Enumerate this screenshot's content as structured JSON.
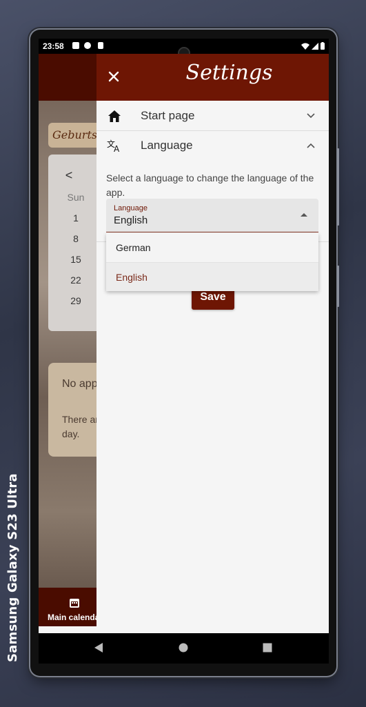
{
  "device": {
    "label": "Samsung Galaxy  S23 Ultra"
  },
  "statusbar": {
    "time": "23:58"
  },
  "background_app": {
    "chip_text": "Geburtst",
    "calendar": {
      "nav": "<",
      "weekday": "Sun",
      "days": [
        "1",
        "8",
        "15",
        "22",
        "29"
      ]
    },
    "card_title": "No app",
    "card_text_1": "There ar",
    "card_text_2": "day.",
    "nav_label": "Main calenda"
  },
  "drawer": {
    "title": "Settings",
    "close_icon": "close-icon",
    "sections": [
      {
        "icon": "home-icon",
        "label": "Start page",
        "expanded": false
      },
      {
        "icon": "translate-icon",
        "label": "Language",
        "expanded": true
      }
    ],
    "language_description": "Select a language to change the language of the app.",
    "select": {
      "label": "Language",
      "value": "English"
    },
    "options": [
      "German",
      "English"
    ],
    "selected_option": "English",
    "save_label": "Save"
  },
  "colors": {
    "primary": "#6e1604",
    "background": "#f5f5f5"
  }
}
